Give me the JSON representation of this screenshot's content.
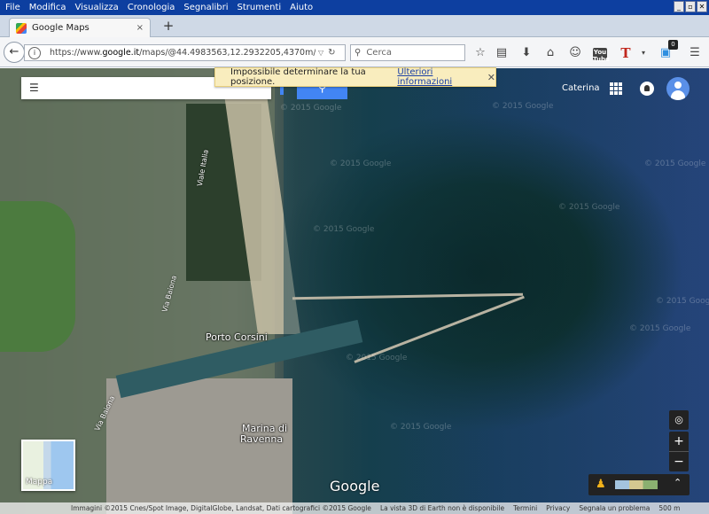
{
  "menubar": {
    "items": [
      "File",
      "Modifica",
      "Visualizza",
      "Cronologia",
      "Segnalibri",
      "Strumenti",
      "Aiuto"
    ]
  },
  "window_controls": [
    "_",
    "▫",
    "✕"
  ],
  "tab": {
    "title": "Google Maps",
    "close": "×"
  },
  "newtab": "+",
  "navbar": {
    "url_prefix": "https://www.",
    "url_domain": "google.it",
    "url_rest": "/maps/@44.4983563,12.2932205,4370m/data=!3m1!",
    "search_placeholder": "Cerca",
    "extension_badge": "0",
    "youtube_label": "You Tube",
    "t_label": "T"
  },
  "notification": {
    "message": "Impossibile determinare la tua posizione.",
    "link": "Ulteriori informazioni",
    "close": "✕"
  },
  "header": {
    "user_name": "Caterina"
  },
  "map": {
    "labels": {
      "porto_corsini": "Porto Corsini",
      "marina_1": "Marina di",
      "marina_2": "Ravenna",
      "viale_italia": "Viale Italia",
      "via_baiona_1": "Via Baiona",
      "via_baiona_2": "Via Baiona"
    },
    "watermark": "© 2015 Google",
    "minimap_label": "Mappa",
    "google_logo": "Google"
  },
  "controls": {
    "zoom_in": "+",
    "zoom_out": "−",
    "expand": "⌃"
  },
  "footer": {
    "imagery": "Immagini ©2015 Cnes/Spot Image, DigitalGlobe, Landsat, Dati cartografici ©2015 Google",
    "earth": "La vista 3D di Earth non è disponibile",
    "terms": "Termini",
    "privacy": "Privacy",
    "report": "Segnala un problema",
    "scale": "500 m"
  }
}
